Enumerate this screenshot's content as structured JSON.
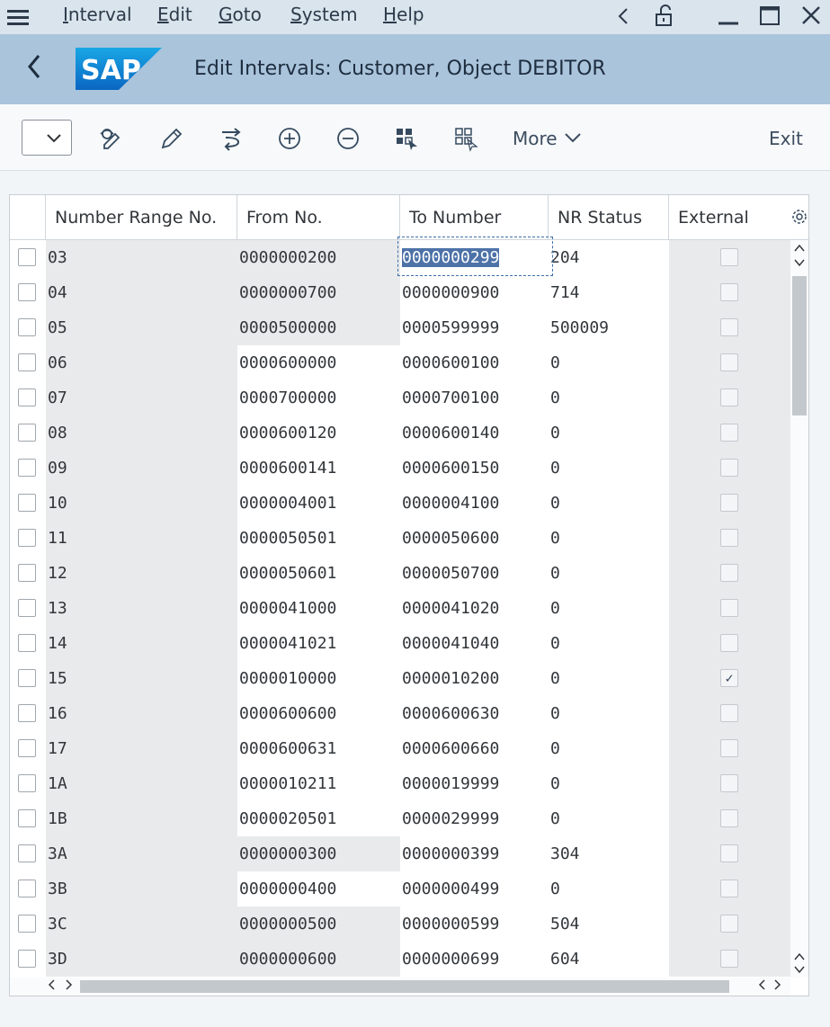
{
  "menubar": {
    "items": [
      {
        "accel": "I",
        "rest": "nterval"
      },
      {
        "accel": "E",
        "rest": "dit"
      },
      {
        "accel": "G",
        "rest": "oto"
      },
      {
        "accel": "S",
        "rest": "ystem"
      },
      {
        "accel": "H",
        "rest": "elp"
      }
    ]
  },
  "titlebar": {
    "title": "Edit Intervals: Customer, Object DEBITOR",
    "logo_text": "SAP",
    "brand_color": "#1a73c9"
  },
  "toolbar": {
    "more_label": "More",
    "exit_label": "Exit"
  },
  "table": {
    "columns": [
      "Number Range No.",
      "From No.",
      "To Number",
      "NR Status",
      "External"
    ],
    "rows": [
      {
        "nr": "03",
        "from": "0000000200",
        "to": "0000000299",
        "status": "204",
        "external": false
      },
      {
        "nr": "04",
        "from": "0000000700",
        "to": "0000000900",
        "status": "714",
        "external": false
      },
      {
        "nr": "05",
        "from": "0000500000",
        "to": "0000599999",
        "status": "500009",
        "external": false
      },
      {
        "nr": "06",
        "from": "0000600000",
        "to": "0000600100",
        "status": "0",
        "external": false
      },
      {
        "nr": "07",
        "from": "0000700000",
        "to": "0000700100",
        "status": "0",
        "external": false
      },
      {
        "nr": "08",
        "from": "0000600120",
        "to": "0000600140",
        "status": "0",
        "external": false
      },
      {
        "nr": "09",
        "from": "0000600141",
        "to": "0000600150",
        "status": "0",
        "external": false
      },
      {
        "nr": "10",
        "from": "0000004001",
        "to": "0000004100",
        "status": "0",
        "external": false
      },
      {
        "nr": "11",
        "from": "0000050501",
        "to": "0000050600",
        "status": "0",
        "external": false
      },
      {
        "nr": "12",
        "from": "0000050601",
        "to": "0000050700",
        "status": "0",
        "external": false
      },
      {
        "nr": "13",
        "from": "0000041000",
        "to": "0000041020",
        "status": "0",
        "external": false
      },
      {
        "nr": "14",
        "from": "0000041021",
        "to": "0000041040",
        "status": "0",
        "external": false
      },
      {
        "nr": "15",
        "from": "0000010000",
        "to": "0000010200",
        "status": "0",
        "external": true
      },
      {
        "nr": "16",
        "from": "0000600600",
        "to": "0000600630",
        "status": "0",
        "external": false
      },
      {
        "nr": "17",
        "from": "0000600631",
        "to": "0000600660",
        "status": "0",
        "external": false
      },
      {
        "nr": "1A",
        "from": "0000010211",
        "to": "0000019999",
        "status": "0",
        "external": false
      },
      {
        "nr": "1B",
        "from": "0000020501",
        "to": "0000029999",
        "status": "0",
        "external": false
      },
      {
        "nr": "3A",
        "from": "0000000300",
        "to": "0000000399",
        "status": "304",
        "external": false
      },
      {
        "nr": "3B",
        "from": "0000000400",
        "to": "0000000499",
        "status": "0",
        "external": false
      },
      {
        "nr": "3C",
        "from": "0000000500",
        "to": "0000000599",
        "status": "504",
        "external": false
      },
      {
        "nr": "3D",
        "from": "0000000600",
        "to": "0000000699",
        "status": "604",
        "external": false
      }
    ]
  }
}
